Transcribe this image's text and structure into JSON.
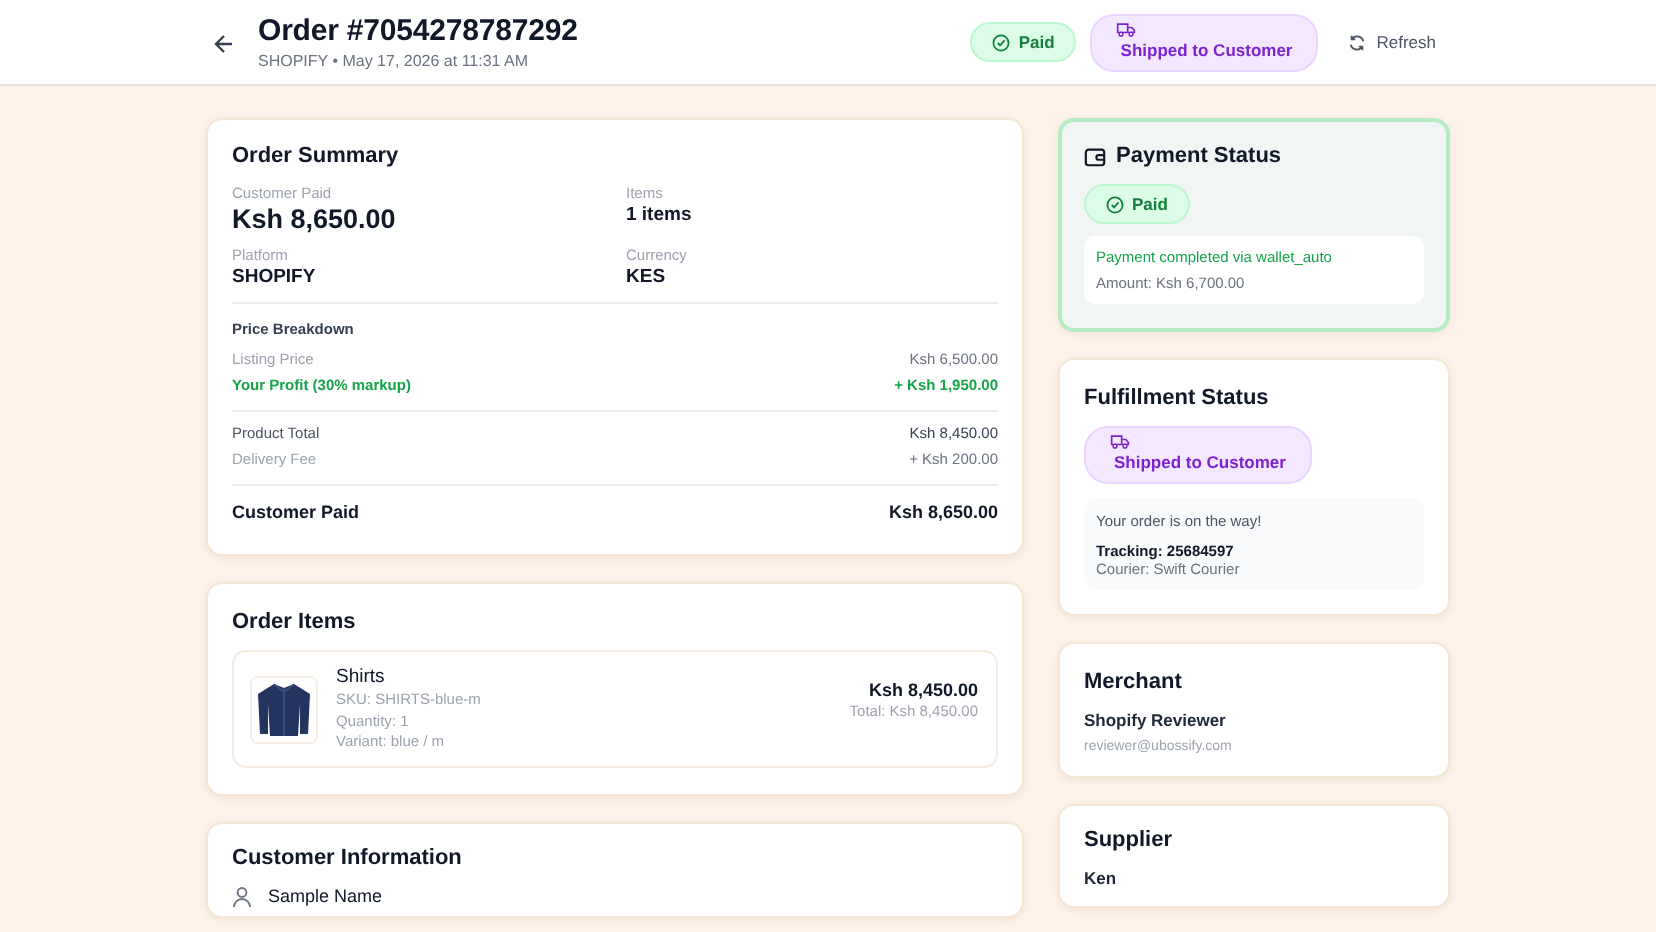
{
  "header": {
    "title": "Order #7054278787292",
    "subtitle": "SHOPIFY • May 17, 2026 at 11:31 AM",
    "badges": [
      {
        "kind": "paid",
        "label": "Paid"
      },
      {
        "kind": "shipped",
        "label": "Shipped to Customer"
      }
    ],
    "refresh": "Refresh"
  },
  "order_summary": {
    "title": "Order Summary",
    "fields": [
      {
        "kind": "large",
        "label": "Customer Paid",
        "value": "Ksh 8,650.00"
      },
      {
        "kind": "normal",
        "label": "Items",
        "value": "1 items"
      },
      {
        "kind": "normal",
        "label": "Platform",
        "value": "SHOPIFY"
      },
      {
        "kind": "normal",
        "label": "Currency",
        "value": "KES"
      }
    ],
    "breakdown_title": "Price Breakdown",
    "breakdown_groups": [
      [
        {
          "kind": "muted",
          "label": "Listing Price",
          "value": "Ksh 6,500.00"
        },
        {
          "kind": "profit",
          "label": "Your Profit (30% markup)",
          "value": "+ Ksh 1,950.00"
        }
      ],
      [
        {
          "kind": "normal",
          "label": "Product Total",
          "value": "Ksh 8,450.00"
        },
        {
          "kind": "muted",
          "label": "Delivery Fee",
          "value": "+ Ksh 200.00"
        }
      ],
      [
        {
          "kind": "total",
          "label": "Customer Paid",
          "value": "Ksh 8,650.00"
        }
      ]
    ]
  },
  "order_items": {
    "title": "Order Items",
    "items": [
      {
        "name": "Shirts",
        "sku": "SKU: SHIRTS-blue-m",
        "quantity": "Quantity: 1",
        "variant": "Variant: blue / m",
        "price": "Ksh 8,450.00",
        "total": "Total: Ksh 8,450.00"
      }
    ]
  },
  "customer": {
    "title": "Customer Information",
    "name": "Sample Name"
  },
  "payment": {
    "title": "Payment Status",
    "badge": {
      "kind": "paid",
      "label": "Paid"
    },
    "message": "Payment completed via wallet_auto",
    "amount": "Amount: Ksh 6,700.00"
  },
  "fulfillment": {
    "title": "Fulfillment Status",
    "badge": {
      "kind": "shipped",
      "label": "Shipped to Customer"
    },
    "message": "Your order is on the way!",
    "tracking": "Tracking: 25684597",
    "courier": "Courier: Swift Courier"
  },
  "merchant": {
    "title": "Merchant",
    "name": "Shopify Reviewer",
    "email": "reviewer@ubossify.com"
  },
  "supplier": {
    "title": "Supplier",
    "name": "Ken"
  }
}
